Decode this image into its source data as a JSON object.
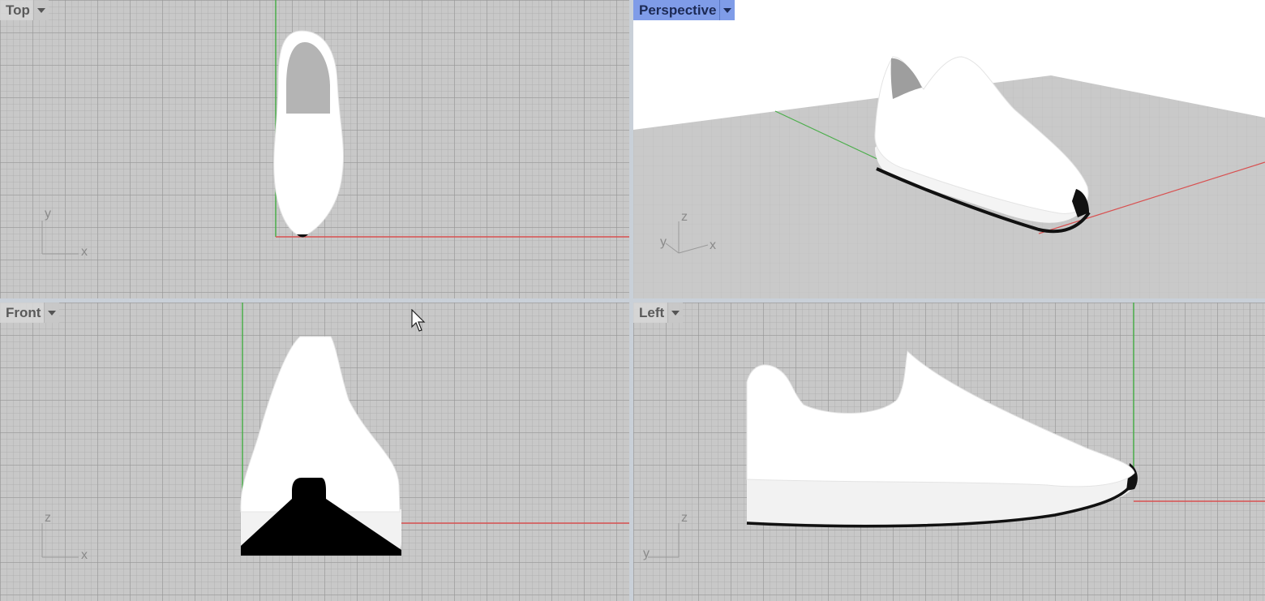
{
  "viewports": {
    "top": {
      "title": "Top",
      "axes": [
        "y",
        "x"
      ]
    },
    "perspective": {
      "title": "Perspective",
      "active": true,
      "axes": [
        "z",
        "y",
        "x"
      ]
    },
    "front": {
      "title": "Front",
      "axes": [
        "z",
        "x"
      ]
    },
    "left": {
      "title": "Left",
      "axes": [
        "z",
        "y"
      ]
    }
  },
  "colors": {
    "viewport_bg": "#c8c8c8",
    "active_tab": "#7f9ce8",
    "x_axis": "#d85050",
    "y_axis": "#4aae4a",
    "model": "#ffffff",
    "sole_edge": "#000000"
  },
  "icons": [
    "dropdown-arrow-icon",
    "mouse-cursor-icon",
    "axis-triad-icon"
  ]
}
